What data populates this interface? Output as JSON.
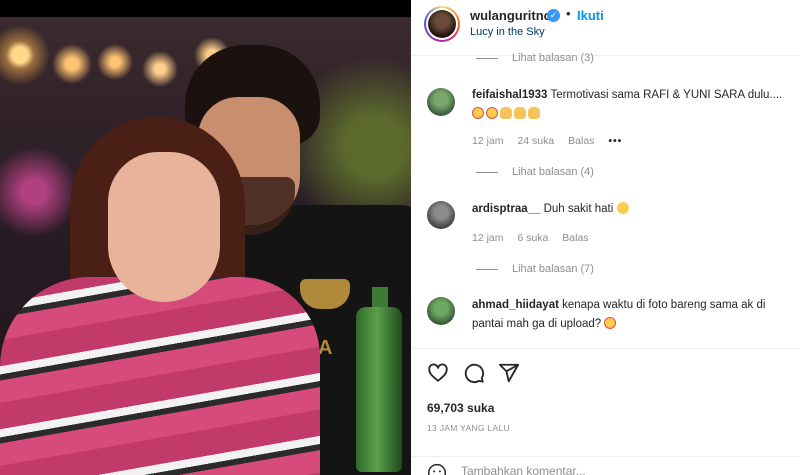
{
  "post": {
    "username": "wulanguritno",
    "follow_label": "Ikuti",
    "song": "Lucy in the Sky",
    "verified": true
  },
  "photo": {
    "shirt_text": "A"
  },
  "comments": [
    {
      "view_replies": "Lihat balasan (3)"
    },
    {
      "user": "feifaishal1933",
      "text": "Termotivasi sama RAFI & YUNI SARA dulu....",
      "emojis": [
        "heart-eyes",
        "heart-eyes",
        "clap",
        "clap",
        "clap"
      ],
      "time": "12 jam",
      "likes": "24 suka",
      "reply": "Balas",
      "more": "•••",
      "view_replies": "Lihat balasan (4)"
    },
    {
      "user": "ardisptraa__",
      "text": "Duh sakit hati",
      "emojis": [
        "sad"
      ],
      "time": "12 jam",
      "likes": "6 suka",
      "reply": "Balas",
      "view_replies": "Lihat balasan (7)"
    },
    {
      "user": "ahmad_hiidayat",
      "text": "kenapa waktu di foto bareng sama ak di pantai mah ga di upload?",
      "emojis": [
        "angry"
      ]
    }
  ],
  "footer": {
    "likes": "69,703 suka",
    "timestamp": "13 JAM YANG LALU",
    "comment_placeholder": "Tambahkan komentar..."
  },
  "colors": {
    "accent": "#0095f6",
    "verified": "#3897f0",
    "muted": "#8e8e8e",
    "text": "#262626"
  },
  "icons": [
    "verified-icon",
    "heart-icon",
    "comment-icon",
    "share-icon",
    "emoji-icon"
  ]
}
